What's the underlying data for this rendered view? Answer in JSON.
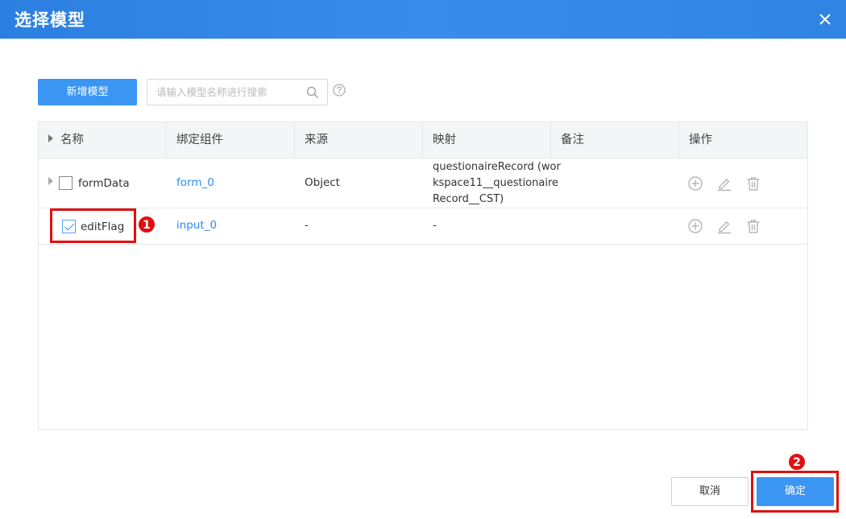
{
  "dialog": {
    "title": "选择模型",
    "close_icon": "close-icon"
  },
  "toolbar": {
    "add_label": "新增模型",
    "search_placeholder": "请输入模型名称进行搜索",
    "search_icon": "search-icon",
    "help_icon": "help-icon"
  },
  "table": {
    "columns": [
      "名称",
      "绑定组件",
      "来源",
      "映射",
      "备注",
      "操作"
    ],
    "rows": [
      {
        "name": "formData",
        "checked": false,
        "expandable": true,
        "component": "form_0",
        "source": "Object",
        "mapping_lines": [
          "questionaireRecord (wor",
          "kspace11__questionaire",
          "Record__CST)"
        ],
        "note": ""
      },
      {
        "name": "editFlag",
        "checked": true,
        "expandable": false,
        "component": "input_0",
        "source": "-",
        "mapping_lines": [
          "-"
        ],
        "note": ""
      }
    ],
    "row_actions": [
      "add-circle-icon",
      "edit-icon",
      "delete-icon"
    ]
  },
  "annotations": {
    "badge_1": "1",
    "badge_2": "2",
    "highlight_color": "#e01010"
  },
  "footer": {
    "cancel_label": "取消",
    "ok_label": "确定"
  },
  "colors": {
    "primary": "#3a95f3",
    "title_bar": "#2f84e4",
    "link": "#2f8cf0"
  }
}
